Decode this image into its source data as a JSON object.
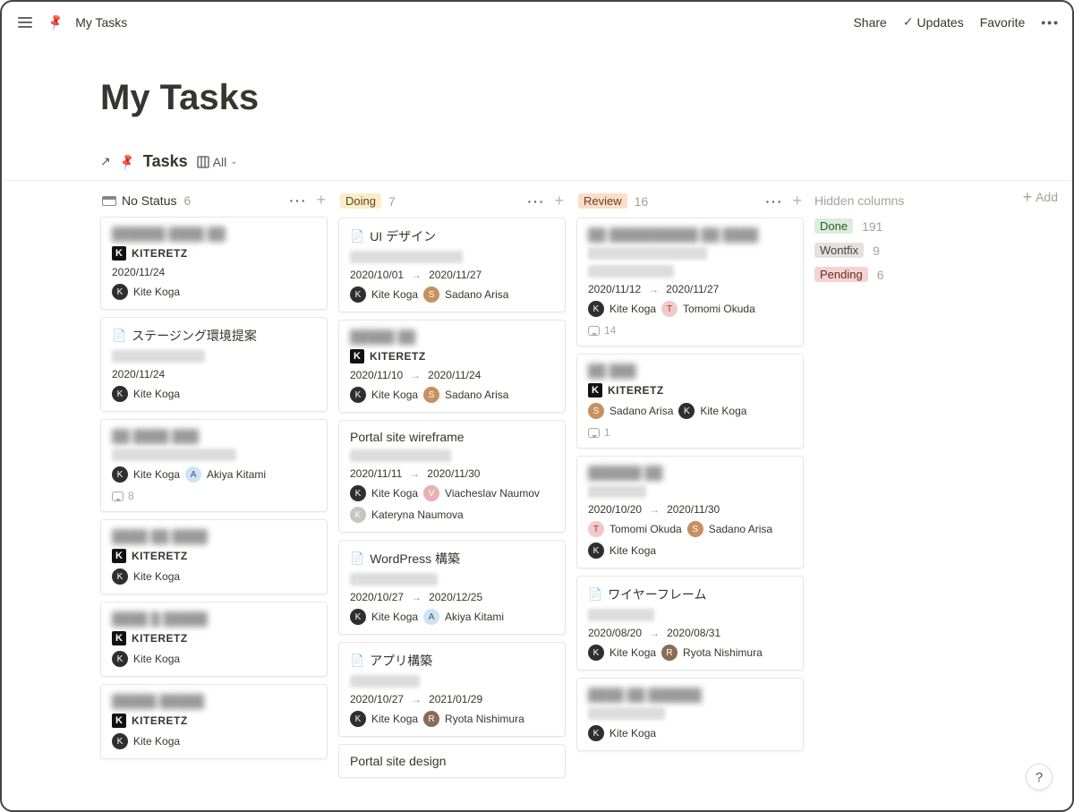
{
  "topbar": {
    "breadcrumb": "My Tasks",
    "share": "Share",
    "updates": "Updates",
    "favorite": "Favorite"
  },
  "page": {
    "title": "My Tasks",
    "db_title": "Tasks",
    "view_label": "All"
  },
  "hidden": {
    "label": "Hidden columns",
    "add_label": "Add",
    "items": [
      {
        "name": "Done",
        "count": "191",
        "pill": "pill-done"
      },
      {
        "name": "Wontfix",
        "count": "9",
        "pill": "pill-wontfix"
      },
      {
        "name": "Pending",
        "count": "6",
        "pill": "pill-pending"
      }
    ]
  },
  "columns": [
    {
      "id": "nostatus",
      "label": "No Status",
      "count": "6",
      "pill": "",
      "cards": [
        {
          "title_blur": true,
          "title": "██████ ████ ██",
          "tag": "KITERETZ",
          "date": "2020/11/24",
          "assignees": [
            {
              "name": "Kite Koga",
              "av": "av-kite"
            }
          ]
        },
        {
          "icon": "doc",
          "title": "ステージング環境提案",
          "subtitle_blur": true,
          "date": "2020/11/24",
          "assignees": [
            {
              "name": "Kite Koga",
              "av": "av-kite"
            }
          ]
        },
        {
          "title_blur": true,
          "title": "██ ████ ███",
          "subtitle_blur": true,
          "assignees": [
            {
              "name": "Kite Koga",
              "av": "av-kite"
            },
            {
              "name": "Akiya Kitami",
              "av": "av-akiya"
            }
          ],
          "comments": "8"
        },
        {
          "title_blur": true,
          "title": "████ ██   ████",
          "tag": "KITERETZ",
          "assignees": [
            {
              "name": "Kite Koga",
              "av": "av-kite"
            }
          ]
        },
        {
          "title_blur": true,
          "title": "████ █ █████",
          "tag": "KITERETZ",
          "assignees": [
            {
              "name": "Kite Koga",
              "av": "av-kite"
            }
          ]
        },
        {
          "title_blur": true,
          "title": "█████ █████",
          "tag": "KITERETZ",
          "assignees": [
            {
              "name": "Kite Koga",
              "av": "av-kite"
            }
          ]
        }
      ]
    },
    {
      "id": "doing",
      "label": "Doing",
      "count": "7",
      "pill": "pill-doing",
      "cards": [
        {
          "icon": "doc",
          "title": "UI デザイン",
          "subtitle_blur": true,
          "date": "2020/10/01 → 2020/11/27",
          "assignees": [
            {
              "name": "Kite Koga",
              "av": "av-kite"
            },
            {
              "name": "Sadano Arisa",
              "av": "av-sadano"
            }
          ]
        },
        {
          "title_blur": true,
          "title": "█████ ██",
          "tag": "KITERETZ",
          "date": "2020/11/10 → 2020/11/24",
          "assignees": [
            {
              "name": "Kite Koga",
              "av": "av-kite"
            },
            {
              "name": "Sadano Arisa",
              "av": "av-sadano"
            }
          ]
        },
        {
          "title": "Portal site wireframe",
          "subtitle_blur": true,
          "date": "2020/11/11 → 2020/11/30",
          "assignees": [
            {
              "name": "Kite Koga",
              "av": "av-kite"
            },
            {
              "name": "Viacheslav Naumov",
              "av": "av-viacheslav"
            },
            {
              "name": "Kateryna Naumova",
              "av": "av-kateryna"
            }
          ]
        },
        {
          "icon": "doc",
          "title": "WordPress 構築",
          "subtitle_blur": true,
          "date": "2020/10/27 → 2020/12/25",
          "assignees": [
            {
              "name": "Kite Koga",
              "av": "av-kite"
            },
            {
              "name": "Akiya Kitami",
              "av": "av-akiya"
            }
          ]
        },
        {
          "icon": "doc",
          "title": "アプリ構築",
          "subtitle_blur": true,
          "date": "2020/10/27 → 2021/01/29",
          "assignees": [
            {
              "name": "Kite Koga",
              "av": "av-kite"
            },
            {
              "name": "Ryota Nishimura",
              "av": "av-ryota"
            }
          ]
        },
        {
          "title": "Portal site design"
        }
      ]
    },
    {
      "id": "review",
      "label": "Review",
      "count": "16",
      "pill": "pill-review",
      "cards": [
        {
          "title_blur": true,
          "title": "██ ██████████ ██ ████",
          "subtitle_blur": true,
          "sub2_blur": true,
          "date": "2020/11/12 → 2020/11/27",
          "assignees": [
            {
              "name": "Kite Koga",
              "av": "av-kite"
            },
            {
              "name": "Tomomi Okuda",
              "av": "av-tomomi"
            }
          ],
          "comments": "14"
        },
        {
          "title_blur": true,
          "title": "██ ███",
          "tag": "KITERETZ",
          "assignees": [
            {
              "name": "Sadano Arisa",
              "av": "av-sadano"
            },
            {
              "name": "Kite Koga",
              "av": "av-kite"
            }
          ],
          "comments": "1"
        },
        {
          "title_blur": true,
          "title": "██████ ██",
          "subtitle_blur": true,
          "date": "2020/10/20 → 2020/11/30",
          "assignees": [
            {
              "name": "Tomomi Okuda",
              "av": "av-tomomi"
            },
            {
              "name": "Sadano Arisa",
              "av": "av-sadano"
            },
            {
              "name": "Kite Koga",
              "av": "av-kite"
            }
          ]
        },
        {
          "icon": "doc",
          "title": "ワイヤーフレーム",
          "subtitle_blur": true,
          "date": "2020/08/20 → 2020/08/31",
          "assignees": [
            {
              "name": "Kite Koga",
              "av": "av-kite"
            },
            {
              "name": "Ryota Nishimura",
              "av": "av-ryota"
            }
          ]
        },
        {
          "title_blur": true,
          "title": "████ ██ ██████",
          "subtitle_blur": true,
          "assignees": [
            {
              "name": "Kite Koga",
              "av": "av-kite"
            }
          ]
        }
      ]
    }
  ]
}
